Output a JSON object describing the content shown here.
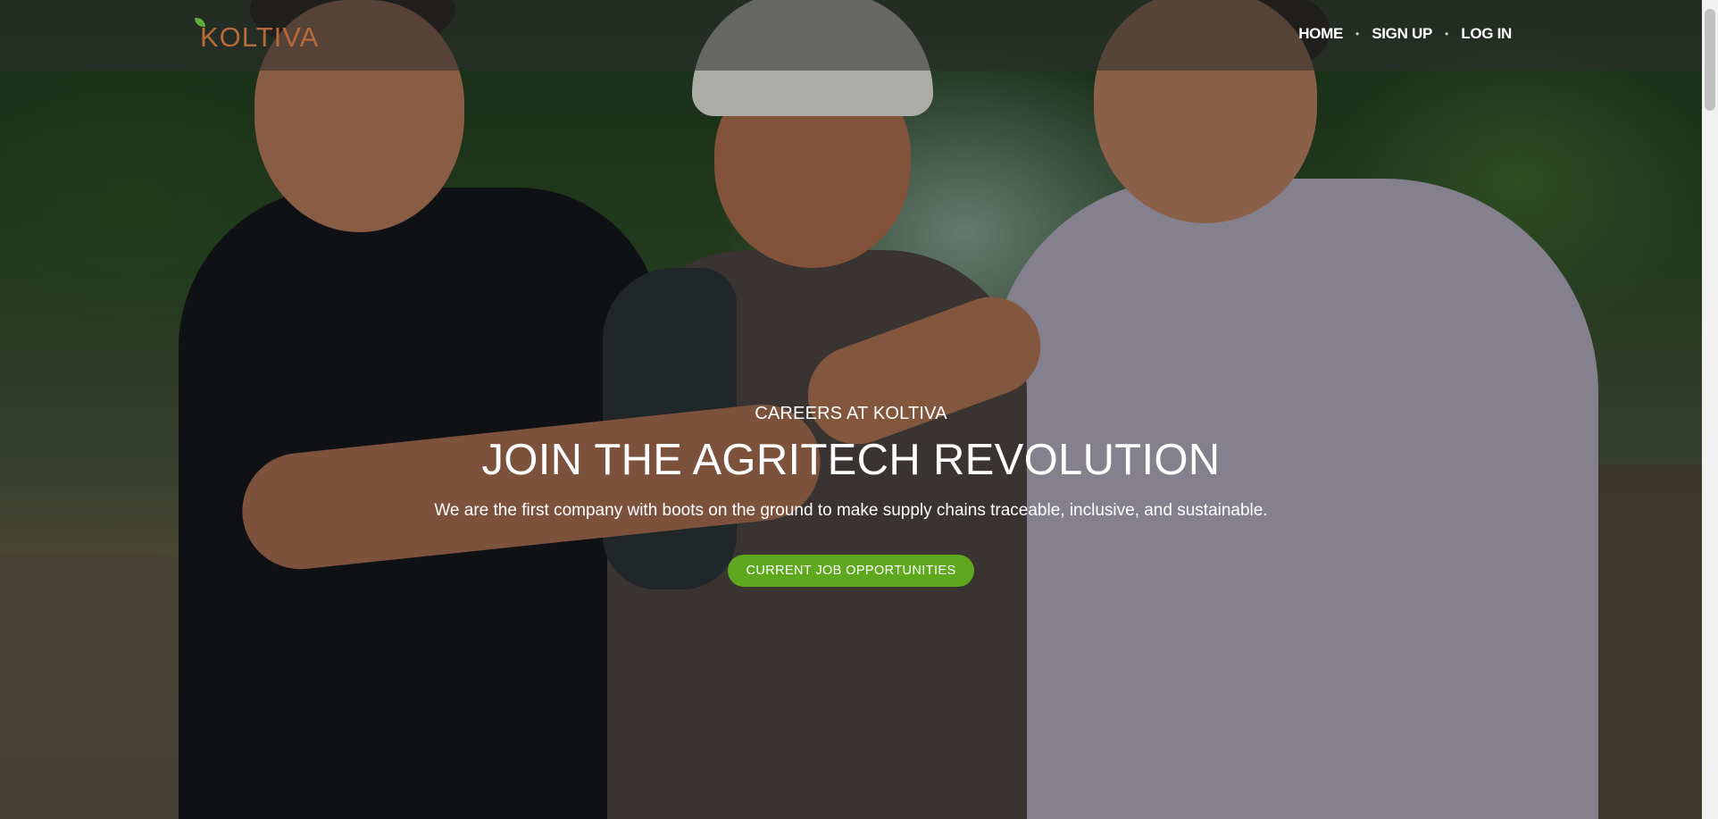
{
  "brand": {
    "logo_text": "KOLTIVA",
    "logo_color": "#b86a3a",
    "leaf_color": "#5fae3a"
  },
  "nav": {
    "items": [
      {
        "label": "HOME"
      },
      {
        "label": "SIGN UP"
      },
      {
        "label": "LOG IN"
      }
    ],
    "separator": "•"
  },
  "hero": {
    "eyebrow": "CAREERS AT KOLTIVA",
    "headline": "JOIN THE AGRITECH REVOLUTION",
    "subheadline": "We are the first company with boots on the ground to make supply chains traceable, inclusive, and sustainable.",
    "cta_label": "CURRENT JOB OPPORTUNITIES",
    "cta_color": "#5ea81e"
  }
}
